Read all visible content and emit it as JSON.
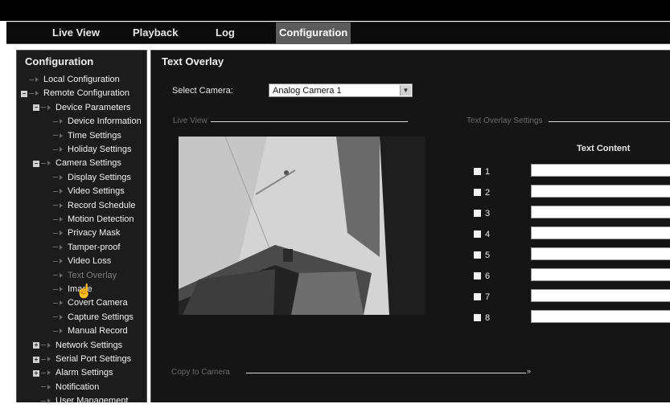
{
  "nav": {
    "tabs": [
      {
        "label": "Live View"
      },
      {
        "label": "Playback"
      },
      {
        "label": "Log"
      },
      {
        "label": "Configuration",
        "active": true
      }
    ]
  },
  "sidebar": {
    "title": "Configuration",
    "items": [
      {
        "label": "Local Configuration",
        "level": 1
      },
      {
        "label": "Remote Configuration",
        "level": 1,
        "toggle": "-"
      },
      {
        "label": "Device Parameters",
        "level": 2,
        "toggle": "-"
      },
      {
        "label": "Device Information",
        "level": 3
      },
      {
        "label": "Time Settings",
        "level": 3
      },
      {
        "label": "Holiday Settings",
        "level": 3
      },
      {
        "label": "Camera Settings",
        "level": 2,
        "toggle": "-"
      },
      {
        "label": "Display Settings",
        "level": 3
      },
      {
        "label": "Video Settings",
        "level": 3
      },
      {
        "label": "Record Schedule",
        "level": 3
      },
      {
        "label": "Motion Detection",
        "level": 3
      },
      {
        "label": "Privacy Mask",
        "level": 3
      },
      {
        "label": "Tamper-proof",
        "level": 3
      },
      {
        "label": "Video Loss",
        "level": 3
      },
      {
        "label": "Text Overlay",
        "level": 3,
        "selected": true
      },
      {
        "label": "Image",
        "level": 3
      },
      {
        "label": "Covert Camera",
        "level": 3
      },
      {
        "label": "Capture Settings",
        "level": 3
      },
      {
        "label": "Manual Record",
        "level": 3
      },
      {
        "label": "Network Settings",
        "level": 2,
        "toggle": "+"
      },
      {
        "label": "Serial Port Settings",
        "level": 2,
        "toggle": "+"
      },
      {
        "label": "Alarm Settings",
        "level": 2,
        "toggle": "+"
      },
      {
        "label": "Notification",
        "level": 2
      },
      {
        "label": "User Management",
        "level": 2
      }
    ]
  },
  "main": {
    "title": "Text Overlay",
    "select_camera_label": "Select Camera:",
    "camera_value": "Analog Camera 1",
    "live_view_label": "Live View",
    "overlay_settings_label": "Text Overlay Settings",
    "text_content_header": "Text Content",
    "rows": [
      "1",
      "2",
      "3",
      "4",
      "5",
      "6",
      "7",
      "8"
    ],
    "copy_to_camera_label": "Copy to Camera"
  },
  "colors": {
    "background": "#151515",
    "active_tab": "#5b5b5b",
    "section_label": "#6a6a6a"
  }
}
